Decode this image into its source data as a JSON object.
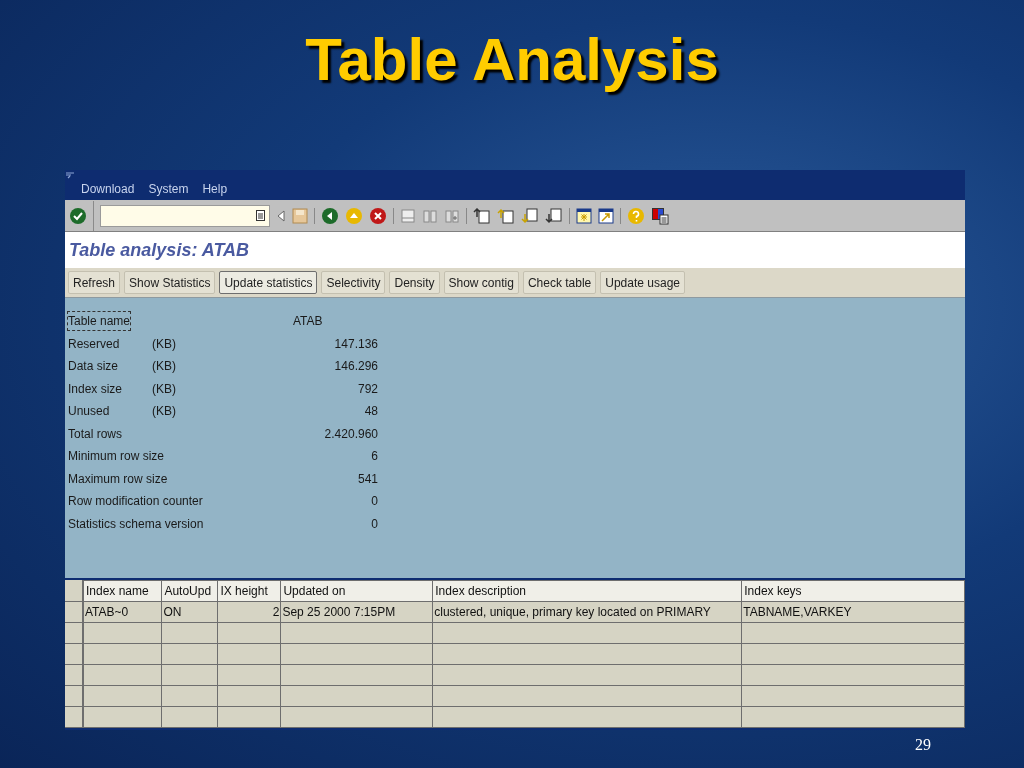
{
  "slide": {
    "title": "Table Analysis",
    "page_number": "29"
  },
  "window": {
    "menu": [
      "Download",
      "System",
      "Help"
    ],
    "screen_title": "Table analysis: ATAB",
    "app_buttons": [
      {
        "label": "Refresh",
        "selected": false
      },
      {
        "label": "Show Statistics",
        "selected": false
      },
      {
        "label": "Update statistics",
        "selected": true
      },
      {
        "label": "Selectivity",
        "selected": false
      },
      {
        "label": "Density",
        "selected": false
      },
      {
        "label": "Show contig",
        "selected": false
      },
      {
        "label": "Check table",
        "selected": false
      },
      {
        "label": "Update usage",
        "selected": false
      }
    ],
    "fields": [
      {
        "label": "Table name",
        "value": "ATAB",
        "focused": true
      },
      {
        "label": "Reserved",
        "unit": "(KB)",
        "value": "147.136",
        "focused": false
      },
      {
        "label": "Data size",
        "unit": "(KB)",
        "value": "146.296",
        "focused": false
      },
      {
        "label": "Index size",
        "unit": "(KB)",
        "value": "792",
        "focused": false
      },
      {
        "label": "Unused",
        "unit": "(KB)",
        "value": "48",
        "focused": false
      },
      {
        "label": "Total rows",
        "value": "2.420.960",
        "focused": false
      },
      {
        "label": "Minimum row size",
        "value": "6",
        "focused": false
      },
      {
        "label": "Maximum row size",
        "value": "541",
        "focused": false
      },
      {
        "label": "Row modification counter",
        "value": "0",
        "focused": false
      },
      {
        "label": "Statistics schema version",
        "value": "0",
        "focused": false
      }
    ],
    "table": {
      "columns": [
        "Index name",
        "AutoUpd",
        "IX height",
        "Updated on",
        "Index description",
        "Index keys"
      ],
      "rows": [
        [
          "ATAB~0",
          "ON",
          "2",
          "Sep 25 2000  7:15PM",
          "clustered, unique, primary key located on PRIMARY",
          "TABNAME,VARKEY"
        ],
        [
          "",
          "",
          "",
          "",
          "",
          ""
        ],
        [
          "",
          "",
          "",
          "",
          "",
          ""
        ],
        [
          "",
          "",
          "",
          "",
          "",
          ""
        ],
        [
          "",
          "",
          "",
          "",
          "",
          ""
        ],
        [
          "",
          "",
          "",
          "",
          "",
          ""
        ]
      ]
    }
  }
}
